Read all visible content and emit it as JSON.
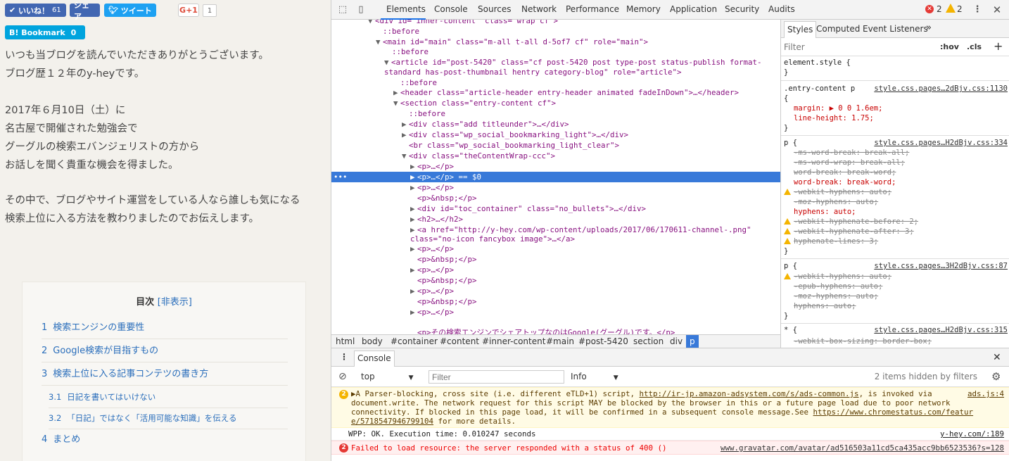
{
  "page": {
    "social": {
      "like_label": "いいね！",
      "like_count": "61",
      "share_label": "シェア",
      "tweet_label": "ツイート",
      "gplus_label": "G+1",
      "gplus_count": "1",
      "hatena_label": "B! Bookmark",
      "hatena_count": "0"
    },
    "paragraphs": [
      "いつも当ブログを読んでいただきありがとうございます。",
      "ブログ歴１２年のy-heyです。",
      "2017年６月10日（土）に",
      "名古屋で開催された勉強会で",
      "グーグルの検索エバンジェリストの方から",
      "お話しを聞く貴重な機会を得ました。",
      "その中で、ブログやサイト運営をしている人なら誰しも気になる",
      "検索上位に入る方法を教わりましたのでお伝えします。"
    ],
    "toc": {
      "title": "目次",
      "toggle": "[非表示]",
      "items": [
        {
          "num": "1",
          "label": "検索エンジンの重要性"
        },
        {
          "num": "2",
          "label": "Google検索が目指すもの"
        },
        {
          "num": "3",
          "label": "検索上位に入る記事コンテツの書き方"
        },
        {
          "num": "3.1",
          "label": "日記を書いてはいけない"
        },
        {
          "num": "3.2",
          "label": "「日記」ではなく「活用可能な知識」を伝える"
        },
        {
          "num": "4",
          "label": "まとめ"
        }
      ]
    }
  },
  "devtools": {
    "tabs": [
      "Elements",
      "Console",
      "Sources",
      "Network",
      "Performance",
      "Memory",
      "Application",
      "Security",
      "Audits"
    ],
    "error_count": "2",
    "warning_count": "2",
    "elements": {
      "lines": [
        "<div id=\"inner-content\" class=\"wrap cf\">",
        "::before",
        "<main id=\"main\" class=\"m-all t-all d-5of7 cf\" role=\"main\">",
        "::before",
        "<article id=\"post-5420\" class=\"cf post-5420 post type-post status-publish format-",
        "standard has-post-thumbnail hentry category-blog\" role=\"article\">",
        "::before",
        "<header class=\"article-header entry-header animated fadeInDown\">…</header>",
        "<section class=\"entry-content cf\">",
        "::before",
        "<div class=\"add titleunder\">…</div>",
        "<div class=\"wp_social_bookmarking_light\">…</div>",
        "<br class=\"wp_social_bookmarking_light_clear\">",
        "<div class=\"theContentWrap-ccc\">",
        "<p>…</p>",
        "<p>…</p> == $0",
        "<p>…</p>",
        "<p>&nbsp;</p>",
        "<div id=\"toc_container\" class=\"no_bullets\">…</div>",
        "<h2>…</h2>",
        "<a href=\"http://y-hey.com/wp-content/uploads/2017/06/170611-channel-.png\"",
        "class=\"no-icon fancybox image\">…</a>",
        "<p>…</p>",
        "<p>&nbsp;</p>",
        "<p>…</p>",
        "<p>&nbsp;</p>",
        "<p>…</p>",
        "<p>&nbsp;</p>",
        "<p>…</p>",
        "<p>その検索エンジンでシェアトップなのはGoogle(グーグル)です。</p>"
      ],
      "breadcrumb": [
        "html",
        "body",
        "#container",
        "#content",
        "#inner-content",
        "#main",
        "#post-5420",
        "section",
        "div",
        "p"
      ]
    },
    "styles": {
      "tabs": [
        "Styles",
        "Computed",
        "Event Listeners",
        "»"
      ],
      "filter_placeholder": "Filter",
      "hov": ":hov",
      "cls": ".cls",
      "plus": "+",
      "lines": [
        "element.style {",
        "}",
        ".entry-content p",
        "{",
        "margin: ▶ 0 0 1.6em;",
        "line-height: 1.75;",
        "}",
        "p {",
        "-ms-word-break: break-all;",
        "-ms-word-wrap: break-all;",
        "word-break: break-word;",
        "word-break: break-word;",
        "-webkit-hyphens: auto;",
        "-moz-hyphens: auto;",
        "hyphens: auto;",
        "-webkit-hyphenate-before: 2;",
        "-webkit-hyphenate-after: 3;",
        "hyphenate-lines: 3;",
        "}",
        "p {",
        "-webkit-hyphens: auto;",
        "-epub-hyphens: auto;",
        "-moz-hyphens: auto;",
        "hyphens: auto;",
        "}",
        "* {",
        "-webkit-box-sizing: border-box;"
      ],
      "sources": [
        "style.css.pages…2dBjv.css:1130",
        "style.css.pages…H2dBjv.css:334",
        "style.css.pages…3H2dBjv.css:87",
        "style.css.pages…H2dBjv.css:315"
      ]
    },
    "console": {
      "tab_label": "Console",
      "context": "top",
      "filter_placeholder": "Filter",
      "level": "Info",
      "hidden_count": "2 items hidden by filters",
      "warn_count": "2",
      "warn_lines": [
        "▶A Parser-blocking, cross site (i.e. different eTLD+1) script,",
        "http://ir-jp.amazon-adsystem.com/s/ads-common.js",
        ", is invoked via",
        "document.write. The network request for this script MAY be blocked by the browser in this or a future page load due to poor network",
        "connectivity. If blocked in this page load, it will be confirmed in a subsequent console message.See",
        "https://www.chromestatus.com/featur",
        "e/5718547946799104",
        "for more details."
      ],
      "warn_source": "ads.js:4",
      "log_text": "WPP: OK. Execution time: 0.010247 seconds",
      "log_source": "y-hey.com/:189",
      "error_count": "2",
      "error_text": "Failed to load resource: the server responded with a status of 400 ()",
      "error_source": "www.gravatar.com/avatar/ad516503a11cd5ca435acc9bb6523536?s=128"
    }
  }
}
